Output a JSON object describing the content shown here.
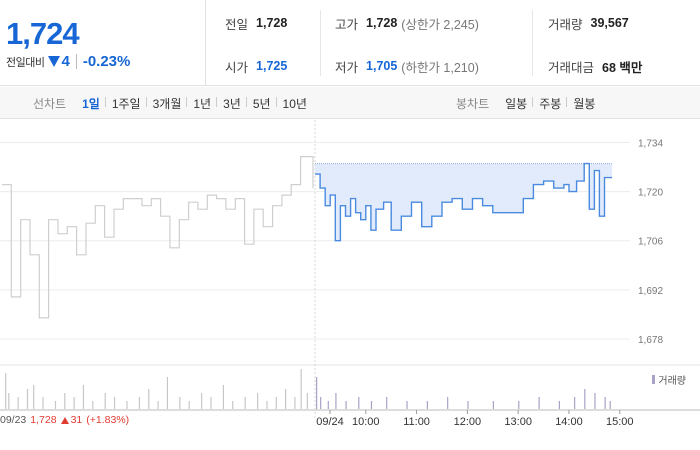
{
  "quote": {
    "current_price": "1,724",
    "change_label": "전일대비",
    "change_abs": "4",
    "change_rate": "-0.23%",
    "direction": "down"
  },
  "info": {
    "prev_close": {
      "label": "전일",
      "value": "1,728"
    },
    "open": {
      "label": "시가",
      "value": "1,725"
    },
    "high": {
      "label": "고가",
      "value": "1,728",
      "sub": "(상한가 2,245)"
    },
    "low": {
      "label": "저가",
      "value": "1,705",
      "sub": "(하한가 1,210)"
    },
    "volume": {
      "label": "거래량",
      "value": "39,567"
    },
    "amount": {
      "label": "거래대금",
      "value": "68 백만"
    }
  },
  "line_tabs": {
    "label": "선차트",
    "items": [
      "1일",
      "1주일",
      "3개월",
      "1년",
      "3년",
      "5년",
      "10년"
    ],
    "active": 0
  },
  "candle_tabs": {
    "label": "봉차트",
    "items": [
      "일봉",
      "주봉",
      "월봉"
    ]
  },
  "colors": {
    "up": "#e03c31",
    "down": "#1766d6",
    "prev_day_line": "#cfcfcf",
    "today_line": "#4a8be0",
    "fill": "#dfe9fb",
    "volume_bar": "#c7c7c7"
  },
  "chart_data": {
    "type": "line",
    "ylim": [
      1672,
      1737
    ],
    "yticks": [
      1734,
      1720,
      1706,
      1692,
      1678
    ],
    "ytick_labels": [
      "1,734",
      "1,720",
      "1,706",
      "1,692",
      "1,678"
    ],
    "reference_price": 1728,
    "xticks": [
      "09/24",
      "10:00",
      "11:00",
      "12:00",
      "13:00",
      "14:00",
      "15:00"
    ],
    "volume_label": "거래량",
    "prev_day": {
      "date": "09/23",
      "close": "1,728",
      "change": "31",
      "change_rate": "(+1.83%)",
      "points": [
        [
          0,
          1722
        ],
        [
          0.03,
          1690
        ],
        [
          0.06,
          1712
        ],
        [
          0.09,
          1702
        ],
        [
          0.12,
          1684
        ],
        [
          0.15,
          1712
        ],
        [
          0.18,
          1708
        ],
        [
          0.21,
          1710
        ],
        [
          0.24,
          1702
        ],
        [
          0.27,
          1711
        ],
        [
          0.3,
          1716
        ],
        [
          0.33,
          1707
        ],
        [
          0.36,
          1715
        ],
        [
          0.39,
          1718
        ],
        [
          0.42,
          1718
        ],
        [
          0.45,
          1716
        ],
        [
          0.48,
          1718
        ],
        [
          0.51,
          1713
        ],
        [
          0.54,
          1704
        ],
        [
          0.57,
          1712
        ],
        [
          0.6,
          1717
        ],
        [
          0.63,
          1715
        ],
        [
          0.66,
          1719
        ],
        [
          0.69,
          1718
        ],
        [
          0.72,
          1715
        ],
        [
          0.75,
          1718
        ],
        [
          0.78,
          1705
        ],
        [
          0.81,
          1715
        ],
        [
          0.84,
          1710
        ],
        [
          0.87,
          1716
        ],
        [
          0.9,
          1719
        ],
        [
          0.93,
          1722
        ],
        [
          0.96,
          1730
        ],
        [
          1,
          1721
        ]
      ]
    },
    "today": {
      "points": [
        [
          9.0,
          1725
        ],
        [
          9.1,
          1721
        ],
        [
          9.2,
          1716
        ],
        [
          9.3,
          1719
        ],
        [
          9.4,
          1706
        ],
        [
          9.5,
          1716
        ],
        [
          9.6,
          1713
        ],
        [
          9.7,
          1718
        ],
        [
          9.8,
          1714
        ],
        [
          9.9,
          1712
        ],
        [
          10.0,
          1716
        ],
        [
          10.1,
          1709
        ],
        [
          10.2,
          1715
        ],
        [
          10.35,
          1717
        ],
        [
          10.5,
          1709
        ],
        [
          10.7,
          1713
        ],
        [
          10.9,
          1717
        ],
        [
          11.1,
          1710
        ],
        [
          11.3,
          1713
        ],
        [
          11.5,
          1717
        ],
        [
          11.7,
          1718
        ],
        [
          11.9,
          1715
        ],
        [
          12.1,
          1718
        ],
        [
          12.3,
          1716
        ],
        [
          12.5,
          1714
        ],
        [
          12.7,
          1714
        ],
        [
          12.9,
          1714
        ],
        [
          13.1,
          1718
        ],
        [
          13.3,
          1722
        ],
        [
          13.5,
          1723
        ],
        [
          13.7,
          1721
        ],
        [
          13.9,
          1722
        ],
        [
          14.0,
          1720
        ],
        [
          14.15,
          1723
        ],
        [
          14.3,
          1728
        ],
        [
          14.4,
          1715
        ],
        [
          14.5,
          1726
        ],
        [
          14.6,
          1713
        ],
        [
          14.7,
          1724
        ],
        [
          14.85,
          1724
        ]
      ]
    },
    "prev_day_volume": [
      [
        0.01,
        9
      ],
      [
        0.02,
        4
      ],
      [
        0.05,
        3
      ],
      [
        0.08,
        5
      ],
      [
        0.1,
        6
      ],
      [
        0.13,
        3
      ],
      [
        0.17,
        2
      ],
      [
        0.2,
        4
      ],
      [
        0.23,
        3
      ],
      [
        0.26,
        6
      ],
      [
        0.29,
        2
      ],
      [
        0.33,
        4
      ],
      [
        0.36,
        3
      ],
      [
        0.4,
        2
      ],
      [
        0.44,
        3
      ],
      [
        0.47,
        5
      ],
      [
        0.5,
        2
      ],
      [
        0.53,
        8
      ],
      [
        0.57,
        3
      ],
      [
        0.6,
        2
      ],
      [
        0.64,
        4
      ],
      [
        0.67,
        3
      ],
      [
        0.71,
        6
      ],
      [
        0.74,
        2
      ],
      [
        0.78,
        3
      ],
      [
        0.82,
        4
      ],
      [
        0.85,
        2
      ],
      [
        0.88,
        3
      ],
      [
        0.91,
        5
      ],
      [
        0.94,
        3
      ],
      [
        0.96,
        10
      ],
      [
        0.98,
        4
      ]
    ],
    "today_volume": [
      [
        9.02,
        8
      ],
      [
        9.1,
        3
      ],
      [
        9.25,
        2
      ],
      [
        9.4,
        4
      ],
      [
        9.6,
        2
      ],
      [
        9.85,
        3
      ],
      [
        10.1,
        2
      ],
      [
        10.4,
        3
      ],
      [
        10.8,
        2
      ],
      [
        11.2,
        2
      ],
      [
        11.6,
        3
      ],
      [
        12.0,
        2
      ],
      [
        12.5,
        2
      ],
      [
        13.0,
        2
      ],
      [
        13.4,
        3
      ],
      [
        13.8,
        2
      ],
      [
        14.1,
        3
      ],
      [
        14.3,
        5
      ],
      [
        14.5,
        4
      ],
      [
        14.7,
        3
      ],
      [
        14.8,
        2
      ]
    ]
  }
}
